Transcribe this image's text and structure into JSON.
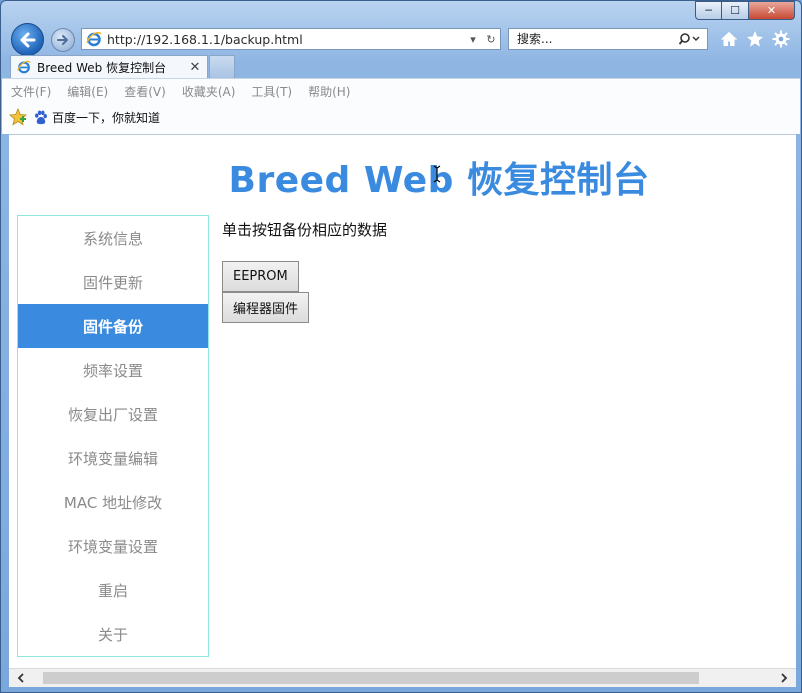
{
  "window": {
    "caption": {
      "minimize_glyph": "─",
      "maximize_glyph": "☐",
      "close_glyph": "✕"
    }
  },
  "nav": {
    "url": "http://192.168.1.1/backup.html",
    "search_placeholder": "搜索...",
    "dropdown_glyph": "▾",
    "refresh_glyph": "↻"
  },
  "tab": {
    "title": "Breed Web 恢复控制台",
    "close_glyph": "✕"
  },
  "menu": {
    "items": [
      "文件(F)",
      "编辑(E)",
      "查看(V)",
      "收藏夹(A)",
      "工具(T)",
      "帮助(H)"
    ]
  },
  "favorites": {
    "link": "百度一下，你就知道"
  },
  "page": {
    "title": "Breed Web 恢复控制台",
    "instruction": "单击按钮备份相应的数据",
    "buttons": {
      "eeprom": "EEPROM",
      "firmware": "编程器固件"
    },
    "sidebar": [
      {
        "label": "系统信息",
        "active": false
      },
      {
        "label": "固件更新",
        "active": false
      },
      {
        "label": "固件备份",
        "active": true
      },
      {
        "label": "频率设置",
        "active": false
      },
      {
        "label": "恢复出厂设置",
        "active": false
      },
      {
        "label": "环境变量编辑",
        "active": false
      },
      {
        "label": "MAC 地址修改",
        "active": false
      },
      {
        "label": "环境变量设置",
        "active": false
      },
      {
        "label": "重启",
        "active": false
      },
      {
        "label": "关于",
        "active": false
      }
    ]
  },
  "colors": {
    "accent": "#3a8be0",
    "sidebar_border": "#8ee6dc",
    "menu_text": "#8a8a8a"
  }
}
